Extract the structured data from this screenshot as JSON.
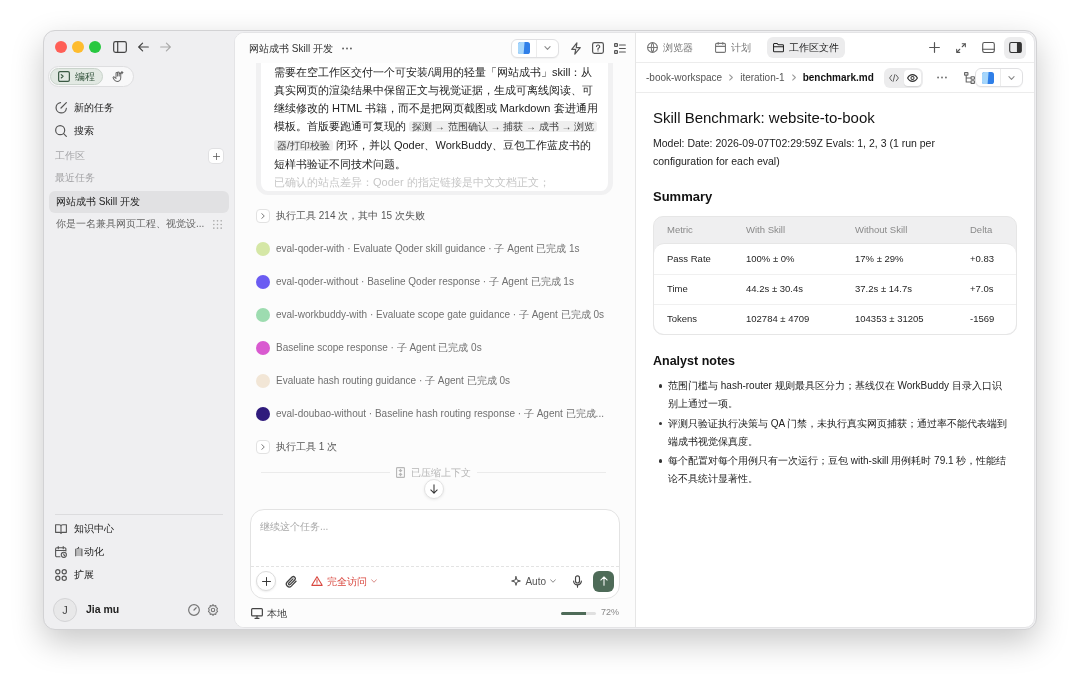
{
  "sidebar": {
    "mode_tabs": [
      {
        "kind": "code",
        "label": "编程",
        "selected": true
      },
      {
        "kind": "hand",
        "selected": false
      }
    ],
    "nav": [
      {
        "kind": "new",
        "label": "新的任务"
      },
      {
        "kind": "search",
        "label": "搜索"
      }
    ],
    "workspace_label": "工作区",
    "recent_label": "最近任务",
    "tasks": [
      {
        "label": "网站成书 Skill 开发",
        "selected": true,
        "hovered": false
      },
      {
        "label": "你是一名兼具网页工程、视觉设...",
        "selected": false,
        "hovered": true
      }
    ],
    "bottom_nav": [
      {
        "kind": "knowledge",
        "label": "知识中心"
      },
      {
        "kind": "automation",
        "label": "自动化"
      },
      {
        "kind": "extensions",
        "label": "扩展"
      }
    ],
    "user": {
      "initial": "J",
      "name": "Jia mu"
    }
  },
  "conversation": {
    "title": "网站成书 Skill 开发",
    "message": {
      "segments": [
        {
          "kind": "text",
          "text": "需要在空工作区交付一个可安装/调用的轻量「网站成书」skill：从真实网页的渲染结果中保留正文与视觉证据，生成可离线阅读、可继续修改的 HTML 书籍，而不是把网页截图或 Markdown 套进通用模板。首版要跑通可复现的 "
        },
        {
          "kind": "code",
          "text": "探测 → 范围确认 → 捕获 → 成书 → 浏览器/打印校验"
        },
        {
          "kind": "text",
          "text": " 闭环，并以 Qoder、WorkBuddy、豆包工作蓝皮书的短样书验证不同技术问题。"
        }
      ],
      "continuation": "已确认的站点差异：Qoder 的指定链接是中文文档正文；"
    },
    "activity": [
      {
        "kind": "tool",
        "text": "执行工具 214 次，其中 15 次失败"
      },
      {
        "kind": "agent",
        "text": "eval-qoder-with · Evaluate Qoder skill guidance · 子 Agent 已完成 1s",
        "color": "#d5e7a6"
      },
      {
        "kind": "agent",
        "text": "eval-qoder-without · Baseline Qoder response · 子 Agent 已完成 1s",
        "color": "#6b5cf2"
      },
      {
        "kind": "agent",
        "text": "eval-workbuddy-with · Evaluate scope gate guidance · 子 Agent 已完成 0s",
        "color": "#9ddcb0"
      },
      {
        "kind": "agent",
        "text": "Baseline scope response · 子 Agent 已完成 0s",
        "color": "#d95ad0"
      },
      {
        "kind": "agent",
        "text": "Evaluate hash routing guidance · 子 Agent 已完成 0s",
        "color": "#f2e6d6"
      },
      {
        "kind": "agent",
        "text": "eval-doubao-without · Baseline hash routing response · 子 Agent 已完成...",
        "color": "#2f1b7c"
      },
      {
        "kind": "tool",
        "text": "执行工具 1 次"
      }
    ],
    "compressed_label": "已压缩上下文",
    "composer": {
      "placeholder": "继续这个任务...",
      "access": "完全访问",
      "model": "Auto"
    },
    "status": {
      "location": "本地",
      "context": {
        "level": 0.72,
        "reading": "72%"
      }
    }
  },
  "file_panel": {
    "tabs": [
      {
        "kind": "browser",
        "label": "浏览器",
        "selected": false
      },
      {
        "kind": "plan",
        "label": "计划",
        "selected": false
      },
      {
        "kind": "files",
        "label": "工作区文件",
        "selected": true
      }
    ],
    "layout_buttons": [
      {
        "kind": "bottom",
        "selected": false
      },
      {
        "kind": "right",
        "selected": true
      }
    ],
    "breadcrumb": [
      {
        "label": "-book-workspace",
        "current": false
      },
      {
        "label": "iteration-1",
        "current": false
      },
      {
        "label": "benchmark.md",
        "current": true
      }
    ],
    "view_modes": [
      {
        "kind": "code",
        "selected": false
      },
      {
        "kind": "preview",
        "selected": true
      }
    ],
    "document": {
      "title": "Skill Benchmark: website-to-book",
      "meta": "Model: Date: 2026-09-07T02:29:59Z Evals: 1, 2, 3 (1 run per configuration for each eval)",
      "summary_heading": "Summary",
      "table": {
        "columns": [
          "Metric",
          "With Skill",
          "Without Skill",
          "Delta"
        ],
        "rows": [
          [
            "Pass Rate",
            "100% ± 0%",
            "17% ± 29%",
            "+0.83"
          ],
          [
            "Time",
            "44.2s ± 30.4s",
            "37.2s ± 14.7s",
            "+7.0s"
          ],
          [
            "Tokens",
            "102784 ± 4709",
            "104353 ± 31205",
            "-1569"
          ]
        ]
      },
      "notes_heading": "Analyst notes",
      "notes": [
        "范围门槛与 hash-router 规则最具区分力；基线仅在 WorkBuddy 目录入口识别上通过一项。",
        "评测只验证执行决策与 QA 门禁，未执行真实网页捕获；通过率不能代表端到端成书视觉保真度。",
        "每个配置对每个用例只有一次运行；豆包 with-skill 用例耗时 79.1 秒，性能结论不具统计显著性。"
      ]
    }
  }
}
